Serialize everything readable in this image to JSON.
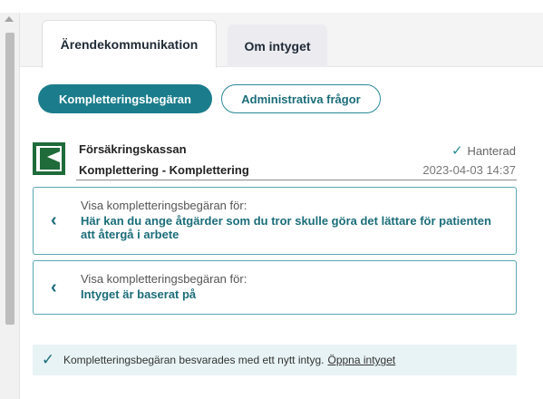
{
  "tabs": [
    {
      "label": "Ärendekommunikation",
      "active": true
    },
    {
      "label": "Om intyget",
      "active": false
    }
  ],
  "filters": [
    {
      "label": "Kompletteringsbegäran",
      "active": true
    },
    {
      "label": "Administrativa frågor",
      "active": false
    }
  ],
  "message": {
    "sender": "Försäkringskassan",
    "subject": "Komplettering - Komplettering",
    "status": "Hanterad",
    "timestamp": "2023-04-03 14:37",
    "logo_icon": "forsakringskassan-logo"
  },
  "requests": [
    {
      "label": "Visa kompletteringsbegäran för:",
      "text": "Här kan du ange åtgärder som du tror skulle göra det lättare för patienten att återgå i arbete"
    },
    {
      "label": "Visa kompletteringsbegäran för:",
      "text": "Intyget är baserat på"
    }
  ],
  "banner": {
    "text": "Kompletteringsbegäran besvarades med ett nytt intyg.",
    "link": "Öppna intyget"
  },
  "colors": {
    "accent": "#1b7d8c",
    "link": "#1b6d79",
    "banner_bg": "#e8f3f5",
    "logo_green": "#1f6b3a"
  }
}
